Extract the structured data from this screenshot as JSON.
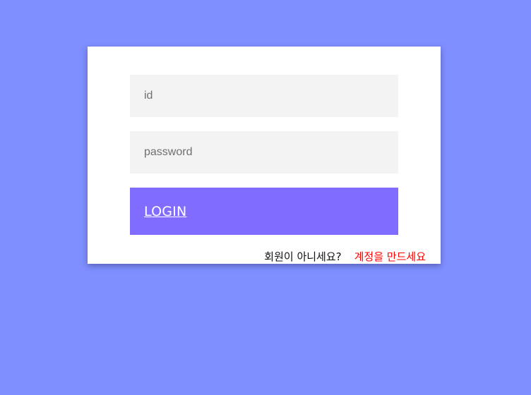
{
  "login_form": {
    "id_placeholder": "id",
    "password_placeholder": "password",
    "login_label": "LOGIN",
    "signup_prompt": "회원이 아니세요?",
    "signup_link": "계정을 만드세요"
  },
  "colors": {
    "background": "#7f8fff",
    "card": "#ffffff",
    "input_background": "#f3f3f3",
    "button": "#806cff",
    "signup_link": "#ff0000"
  }
}
